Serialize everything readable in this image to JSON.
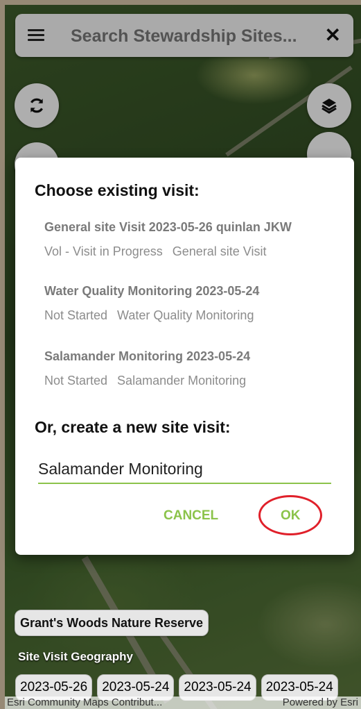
{
  "search": {
    "placeholder": "Search Stewardship Sites..."
  },
  "icons": {
    "menu": "menu-icon",
    "close": "close-icon",
    "refresh": "refresh-icon",
    "layers": "layers-icon"
  },
  "dialog": {
    "title": "Choose existing visit:",
    "visits": [
      {
        "title": "General site Visit 2023-05-26 quinlan JKW",
        "status": "Vol - Visit in Progress",
        "type": "General site Visit"
      },
      {
        "title": "Water Quality Monitoring 2023-05-24",
        "status": "Not Started",
        "type": "Water Quality Monitoring"
      },
      {
        "title": "Salamander Monitoring 2023-05-24",
        "status": "Not Started",
        "type": "Salamander Monitoring"
      }
    ],
    "new_title": "Or, create a new site visit:",
    "new_value": "Salamander Monitoring",
    "cancel_label": "CANCEL",
    "ok_label": "OK"
  },
  "map": {
    "site_name": "Grant's Woods Nature Reserve",
    "geo_label": "Site Visit Geography",
    "dates": [
      "2023-05-26",
      "2023-05-24",
      "2023-05-24",
      "2023-05-24"
    ],
    "attribution_left": "Esri Community Maps Contribut...",
    "attribution_right": "Powered by Esri"
  },
  "colors": {
    "accent": "#8bc34a",
    "highlight_circle": "#e0202a"
  }
}
